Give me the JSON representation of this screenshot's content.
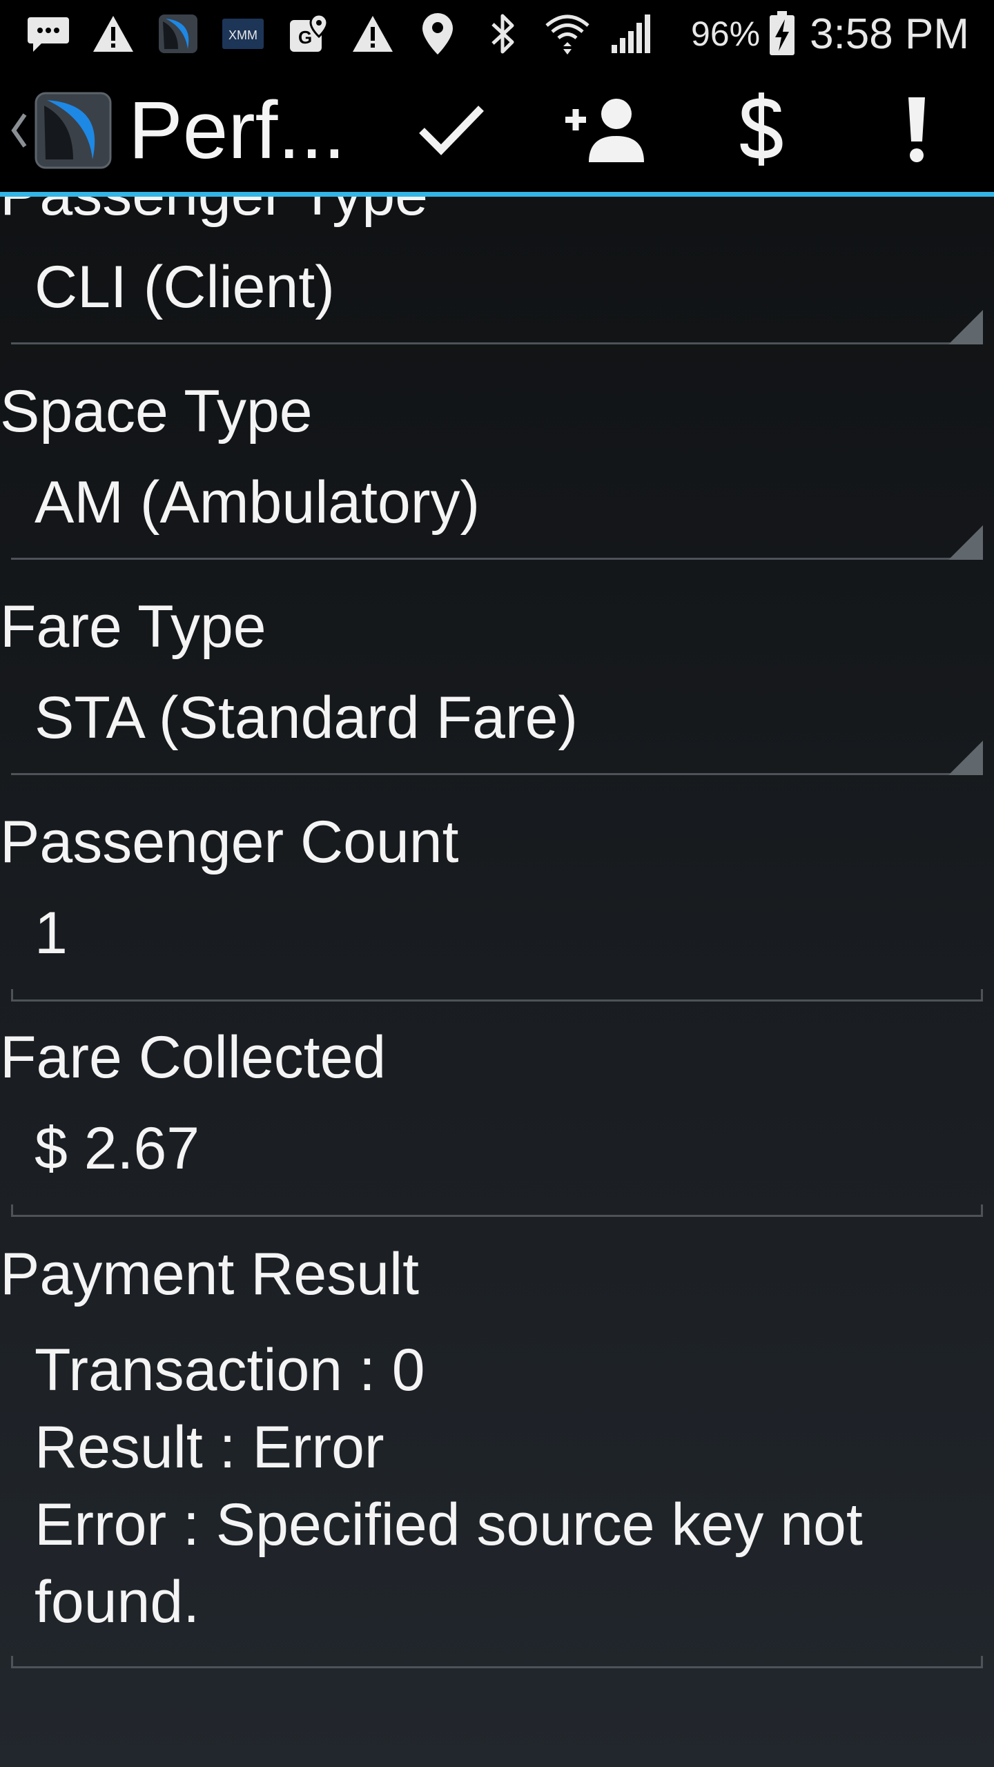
{
  "status_bar": {
    "icons": [
      "message-icon",
      "warning-icon",
      "app-icon",
      "xmm-icon",
      "map-icon",
      "warning-icon",
      "location-icon",
      "bluetooth-icon",
      "wifi-icon",
      "signal-icon"
    ],
    "xmm_label": "XMM",
    "battery_percent": "96%",
    "time": "3:58 PM"
  },
  "action_bar": {
    "title": "Perf...",
    "accent_color": "#33b5e5",
    "actions": [
      "check-icon",
      "add-person-icon",
      "dollar-icon",
      "exclamation-icon"
    ]
  },
  "form": {
    "passenger_type": {
      "label": "Passenger Type",
      "value": "CLI (Client)"
    },
    "space_type": {
      "label": "Space Type",
      "value": "AM (Ambulatory)"
    },
    "fare_type": {
      "label": "Fare Type",
      "value": "STA (Standard Fare)"
    },
    "passenger_count": {
      "label": "Passenger Count",
      "value": "1"
    },
    "fare_collected": {
      "label": "Fare Collected",
      "value": "$ 2.67"
    },
    "payment_result": {
      "label": "Payment Result",
      "value": "Transaction : 0\nResult : Error\nError : Specified source key not found."
    }
  }
}
